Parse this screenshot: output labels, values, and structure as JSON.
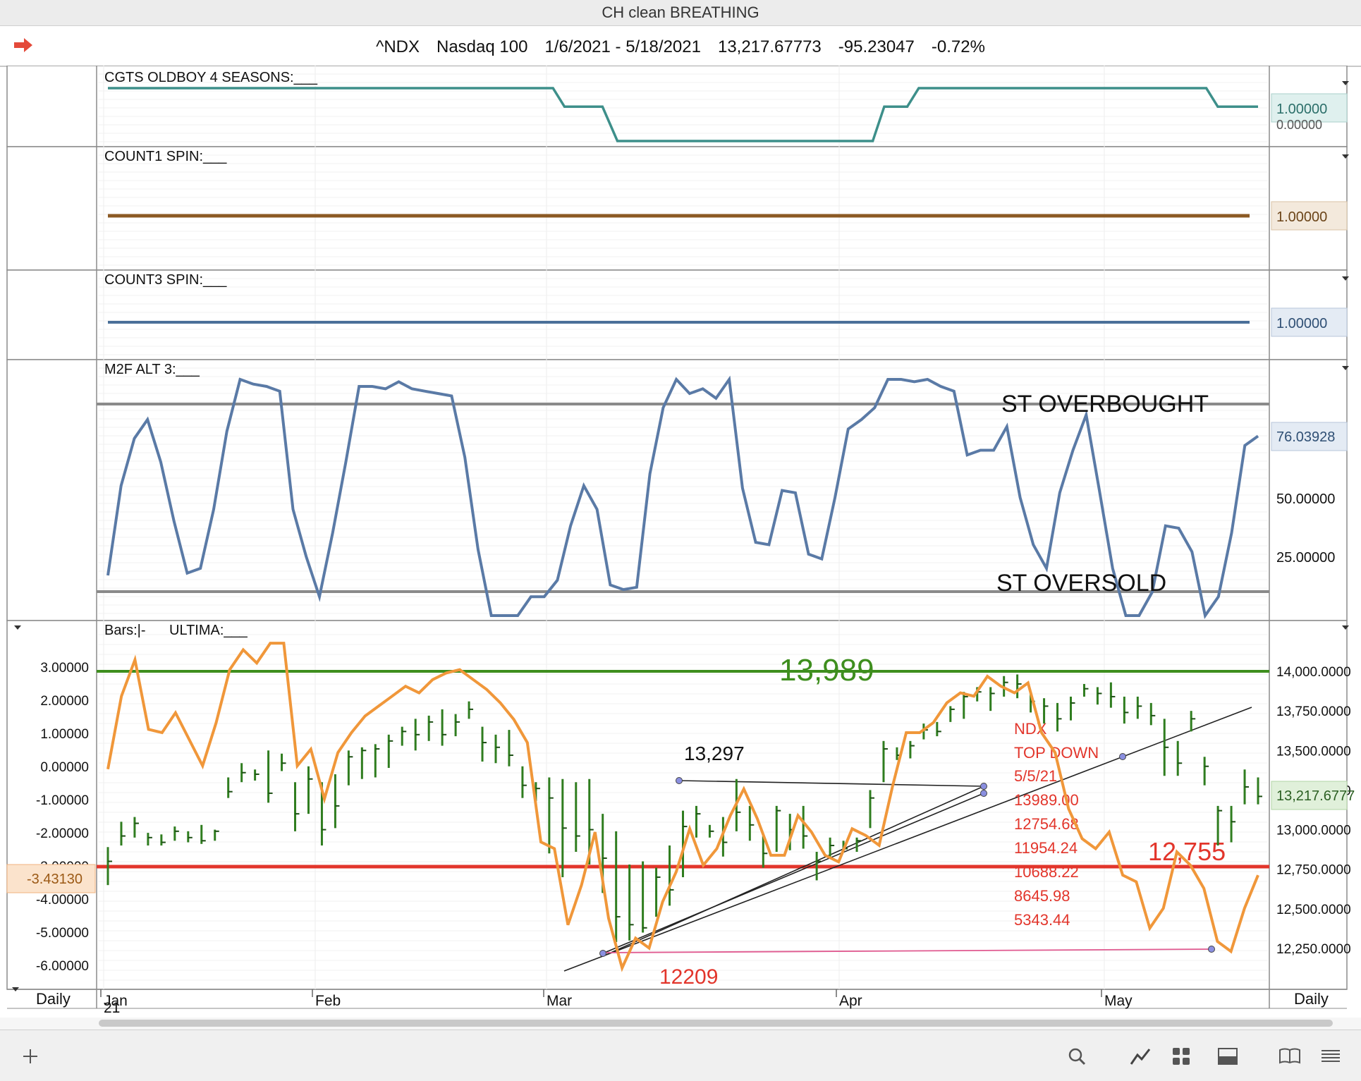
{
  "window": {
    "title": "CH clean BREATHING"
  },
  "info": {
    "symbol": "^NDX",
    "name": "Nasdaq 100",
    "range": "1/6/2021 - 5/18/2021",
    "last": "13,217.67773",
    "change": "-95.23047",
    "pct": "-0.72%"
  },
  "colors": {
    "teal": "#3d8f8a",
    "brown": "#8c5a24",
    "steel": "#4a6f98",
    "m2f": "#5a7aa6",
    "orange": "#f0973a",
    "green_bar": "#2f7d1f",
    "green_line": "#3e8e1e",
    "red_line": "#e2352b",
    "gray_line": "#8a8a8a",
    "pink": "#e05a90"
  },
  "panels": {
    "p1": {
      "label": "CGTS OLDBOY 4 SEASONS:___",
      "value": "1.00000",
      "value2": "0.00000",
      "steps": [
        [
          0,
          1
        ],
        [
          0.387,
          1
        ],
        [
          0.397,
          0.65
        ],
        [
          0.43,
          0.65
        ],
        [
          0.443,
          0
        ],
        [
          0.665,
          0
        ],
        [
          0.675,
          0.65
        ],
        [
          0.695,
          0.65
        ],
        [
          0.705,
          1
        ],
        [
          0.955,
          1
        ],
        [
          0.965,
          0.65
        ],
        [
          1,
          0.65
        ]
      ]
    },
    "p2": {
      "label": "COUNT1 SPIN:___",
      "value": "1.00000"
    },
    "p3": {
      "label": "COUNT3 SPIN:___",
      "value": "1.00000"
    },
    "p4": {
      "label": "M2F ALT 3:___",
      "value": "76.03928",
      "ticks": [
        "50.00000",
        "25.00000"
      ],
      "overbought": "ST OVERBOUGHT",
      "oversold": "ST OVERSOLD",
      "series": [
        17,
        55,
        75,
        83,
        65,
        40,
        18,
        20,
        45,
        78,
        100,
        98,
        97,
        95,
        45,
        25,
        8,
        35,
        65,
        97,
        97,
        96,
        99,
        96,
        95,
        94,
        93,
        67,
        28,
        0,
        0,
        0,
        8,
        8,
        15,
        38,
        55,
        45,
        13,
        11,
        12,
        60,
        88,
        100,
        94,
        96,
        92,
        100,
        54,
        31,
        30,
        53,
        52,
        26,
        24,
        50,
        79,
        83,
        88,
        100,
        100,
        99,
        100,
        97,
        95,
        68,
        70,
        70,
        80,
        50,
        30,
        20,
        52,
        70,
        85,
        53,
        20,
        0,
        0,
        10,
        38,
        37,
        27,
        0,
        8,
        35,
        72,
        76
      ]
    },
    "p5": {
      "label_bars": "Bars:|-",
      "label_ultima": "ULTIMA:___",
      "left_ticks": [
        "3.00000",
        "2.00000",
        "1.00000",
        "0.00000",
        "-1.00000",
        "-2.00000",
        "-3.00000",
        "-4.00000",
        "-5.00000",
        "-6.00000"
      ],
      "left_value": "-3.43130",
      "right_ticks": [
        "14,000.0000",
        "13,750.0000",
        "13,500.0000",
        "13,250.0000",
        "13,000.0000",
        "12,750.0000",
        "12,500.0000",
        "12,250.0000"
      ],
      "right_value": "13,217.6777",
      "level_high": "13,989",
      "level_low": "12,755",
      "level_bottom": "12209",
      "note_13297": "13,297",
      "note_lines": [
        "NDX",
        "TOP DOWN",
        "5/5/21",
        "13989.00",
        "12754.68",
        "11954.24",
        "10688.22",
        "8645.98",
        "5343.44"
      ],
      "x_months": [
        "Jan",
        "Feb",
        "Mar",
        "Apr",
        "May"
      ],
      "x_year": "21",
      "timeframe": "Daily",
      "ultima": [
        -0.1,
        2.1,
        3.2,
        1.1,
        1.0,
        1.6,
        0.8,
        0,
        1.3,
        2.9,
        3.5,
        3.1,
        3.7,
        3.7,
        0,
        0.5,
        -1,
        0.4,
        1.0,
        1.5,
        1.8,
        2.1,
        2.4,
        2.2,
        2.6,
        2.8,
        2.9,
        2.6,
        2.3,
        1.9,
        1.4,
        0.7,
        -2.3,
        -2.5,
        -4.8,
        -3.6,
        -2,
        -4.6,
        -6.1,
        -5.2,
        -5.5,
        -4.1,
        -3.2,
        -1.9,
        -3,
        -2.5,
        -1.5,
        -0.7,
        -1.6,
        -2.7,
        -2.7,
        -1.5,
        -2.0,
        -2.7,
        -2.9,
        -1.9,
        -2.1,
        -2.4,
        -0.6,
        1.0,
        1.0,
        1.3,
        1.9,
        2.2,
        2.1,
        2.7,
        2.4,
        2.2,
        2.5,
        1.0,
        0.4,
        -1.3,
        -2.2,
        -2.5,
        -2,
        -3.3,
        -3.5,
        -4.9,
        -4.3,
        -2.6,
        -3.0,
        -3.7,
        -5.3,
        -5.6,
        -4.3,
        -3.3
      ]
    },
    "bars": [
      [
        12890,
        12650,
        12800
      ],
      [
        13050,
        12900,
        12960
      ],
      [
        13080,
        12950,
        13040
      ],
      [
        12980,
        12900,
        12950
      ],
      [
        12970,
        12900,
        12920
      ],
      [
        13020,
        12930,
        12990
      ],
      [
        12990,
        12920,
        12950
      ],
      [
        13030,
        12910,
        12930
      ],
      [
        13000,
        12930,
        12990
      ],
      [
        13330,
        13200,
        13240
      ],
      [
        13420,
        13300,
        13360
      ],
      [
        13380,
        13310,
        13350
      ],
      [
        13500,
        13170,
        13230
      ],
      [
        13480,
        13370,
        13420
      ],
      [
        13300,
        12990,
        13100
      ],
      [
        13400,
        13100,
        13320
      ],
      [
        13300,
        12900,
        13000
      ],
      [
        13350,
        13010,
        13150
      ],
      [
        13500,
        13280,
        13460
      ],
      [
        13520,
        13320,
        13500
      ],
      [
        13540,
        13330,
        13510
      ],
      [
        13600,
        13390,
        13560
      ],
      [
        13650,
        13530,
        13620
      ],
      [
        13700,
        13500,
        13600
      ],
      [
        13720,
        13560,
        13680
      ],
      [
        13760,
        13530,
        13600
      ],
      [
        13730,
        13590,
        13680
      ],
      [
        13810,
        13700,
        13760
      ],
      [
        13650,
        13430,
        13550
      ],
      [
        13600,
        13420,
        13520
      ],
      [
        13630,
        13400,
        13470
      ],
      [
        13400,
        13200,
        13280
      ],
      [
        13300,
        13180,
        13260
      ],
      [
        13330,
        12850,
        13200
      ],
      [
        13320,
        12700,
        13010
      ],
      [
        13300,
        12860,
        12960
      ],
      [
        13320,
        12780,
        13000
      ],
      [
        13100,
        12600,
        12820
      ],
      [
        12990,
        12290,
        12450
      ],
      [
        12780,
        12300,
        12400
      ],
      [
        12800,
        12350,
        12380
      ],
      [
        12760,
        12450,
        12700
      ],
      [
        12900,
        12520,
        12620
      ],
      [
        13120,
        12700,
        13020
      ],
      [
        13150,
        12950,
        13100
      ],
      [
        13030,
        12950,
        12990
      ],
      [
        13080,
        12830,
        12920
      ],
      [
        13320,
        12990,
        13110
      ],
      [
        13150,
        12930,
        13030
      ],
      [
        12960,
        12760,
        12850
      ],
      [
        13150,
        12860,
        13120
      ],
      [
        13100,
        12870,
        13000
      ],
      [
        13150,
        12880,
        12960
      ],
      [
        12860,
        12680,
        12800
      ],
      [
        12950,
        12830,
        12900
      ],
      [
        12930,
        12860,
        12880
      ],
      [
        12950,
        12860,
        12930
      ],
      [
        13250,
        13010,
        13200
      ],
      [
        13560,
        13300,
        13510
      ],
      [
        13520,
        13440,
        13470
      ],
      [
        13560,
        13450,
        13530
      ],
      [
        13670,
        13570,
        13630
      ],
      [
        13680,
        13590,
        13620
      ],
      [
        13780,
        13680,
        13760
      ],
      [
        13870,
        13700,
        13840
      ],
      [
        13900,
        13810,
        13870
      ],
      [
        13900,
        13750,
        13860
      ],
      [
        13970,
        13840,
        13930
      ],
      [
        13980,
        13830,
        13920
      ],
      [
        13860,
        13740,
        13810
      ],
      [
        13830,
        13670,
        13780
      ],
      [
        13800,
        13620,
        13700
      ],
      [
        13840,
        13690,
        13800
      ],
      [
        13920,
        13840,
        13890
      ],
      [
        13900,
        13790,
        13860
      ],
      [
        13930,
        13770,
        13840
      ],
      [
        13840,
        13670,
        13740
      ],
      [
        13840,
        13700,
        13780
      ],
      [
        13800,
        13660,
        13720
      ],
      [
        13700,
        13340,
        13520
      ],
      [
        13560,
        13340,
        13420
      ],
      [
        13750,
        13620,
        13700
      ],
      [
        13460,
        13280,
        13400
      ],
      [
        13150,
        12900,
        13120
      ],
      [
        13150,
        12920,
        13050
      ],
      [
        13380,
        13160,
        13270
      ],
      [
        13330,
        13160,
        13210
      ]
    ]
  },
  "toolbar": {
    "icons": [
      "plus-icon",
      "search-icon",
      "draw-line-icon",
      "grid-icon",
      "window-layout-icon",
      "book-icon",
      "menu-icon"
    ]
  }
}
